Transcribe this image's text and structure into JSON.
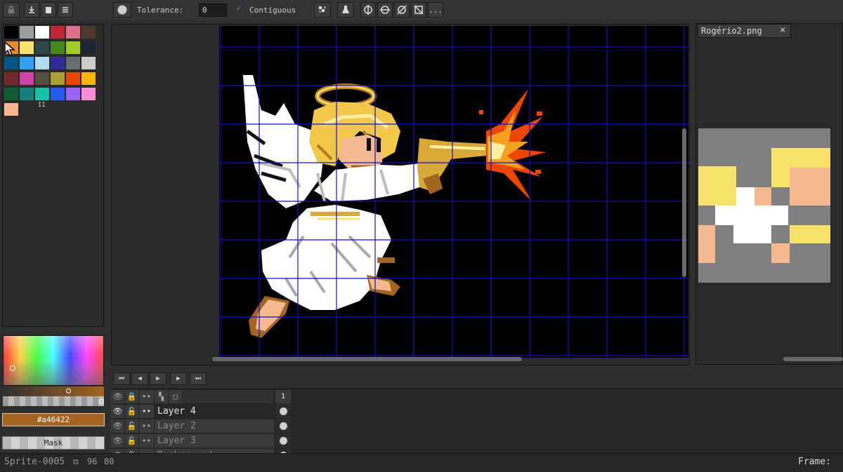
{
  "toolbar": {
    "tolerance_label": "Tolerance:",
    "tolerance_value": "0",
    "contiguous_label": "Contiguous",
    "more_label": "..."
  },
  "palette": {
    "swatches": [
      "#000000",
      "#9e9e9e",
      "#ffffff",
      "#be2633",
      "#e06f8b",
      "#493c2b",
      "#eb8931",
      "#f7e26b",
      "#2f484e",
      "#44891a",
      "#a3ce27",
      "#1b2632",
      "#005784",
      "#31a2f2",
      "#b2dcef",
      "#342a97",
      "#656d71",
      "#cccccc",
      "#732930",
      "#cb43a7",
      "#524f40",
      "#ad9d33",
      "#ec4700",
      "#fab40b",
      "#115e33",
      "#14807e",
      "#15c2a5",
      "#225af6",
      "#9964f9",
      "#f78ed6",
      "#f4b990"
    ],
    "marker": "II"
  },
  "color": {
    "current_hex": "#a46422",
    "mask_label": "Mask"
  },
  "canvas_tab": {
    "filename": "Rogério2.png",
    "close_glyph": "×"
  },
  "playback": {
    "first": "⏮",
    "prev": "◀",
    "play": "▶",
    "next": "▶",
    "last": "⏭"
  },
  "layers": {
    "frame_number": "1",
    "rows": [
      {
        "name": "Layer 4",
        "active": true
      },
      {
        "name": "Layer 2",
        "active": false
      },
      {
        "name": "Layer 3",
        "active": false
      },
      {
        "name": "Background",
        "active": false
      }
    ]
  },
  "status": {
    "sprite_name": "Sprite-0005",
    "width": "96",
    "height": "80",
    "frame_label": "Frame:"
  },
  "colors": {
    "grid": "#1010c8",
    "accent": "#a46422",
    "canvas_bg": "#000000"
  }
}
